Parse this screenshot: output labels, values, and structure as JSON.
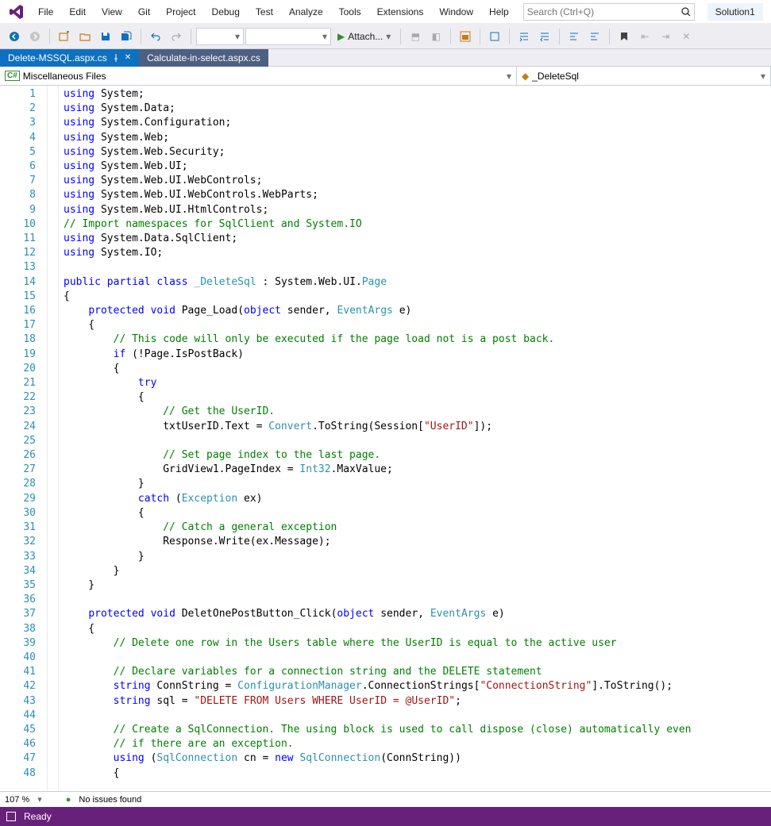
{
  "menu": {
    "items": [
      "File",
      "Edit",
      "View",
      "Git",
      "Project",
      "Debug",
      "Test",
      "Analyze",
      "Tools",
      "Extensions",
      "Window",
      "Help"
    ]
  },
  "search": {
    "placeholder": "Search (Ctrl+Q)"
  },
  "solution": {
    "label": "Solution1"
  },
  "toolbar": {
    "attach_label": "Attach..."
  },
  "tabs": [
    {
      "label": "Delete-MSSQL.aspx.cs",
      "active": true,
      "pinned": true
    },
    {
      "label": "Calculate-in-select.aspx.cs",
      "active": false,
      "pinned": false
    }
  ],
  "nav": {
    "left": "Miscellaneous Files",
    "right": "_DeleteSql"
  },
  "status": {
    "zoom": "107 %",
    "issues": "No issues found",
    "ready": "Ready"
  },
  "code": {
    "lines": [
      {
        "n": 1,
        "html": "<span class='kw'>using</span> System;"
      },
      {
        "n": 2,
        "html": "<span class='kw'>using</span> System.Data;"
      },
      {
        "n": 3,
        "html": "<span class='kw'>using</span> System.Configuration;"
      },
      {
        "n": 4,
        "html": "<span class='kw'>using</span> System.Web;"
      },
      {
        "n": 5,
        "html": "<span class='kw'>using</span> System.Web.Security;"
      },
      {
        "n": 6,
        "html": "<span class='kw'>using</span> System.Web.UI;"
      },
      {
        "n": 7,
        "html": "<span class='kw'>using</span> System.Web.UI.WebControls;"
      },
      {
        "n": 8,
        "html": "<span class='kw'>using</span> System.Web.UI.WebControls.WebParts;"
      },
      {
        "n": 9,
        "html": "<span class='kw'>using</span> System.Web.UI.HtmlControls;"
      },
      {
        "n": 10,
        "html": "<span class='cm'>// Import namespaces for SqlClient and System.IO</span>"
      },
      {
        "n": 11,
        "html": "<span class='kw'>using</span> System.Data.SqlClient;"
      },
      {
        "n": 12,
        "html": "<span class='kw'>using</span> System.IO;"
      },
      {
        "n": 13,
        "html": ""
      },
      {
        "n": 14,
        "html": "<span class='kw'>public</span> <span class='kw'>partial</span> <span class='kw'>class</span> <span class='type'>_DeleteSql</span> : System.Web.UI.<span class='type'>Page</span>"
      },
      {
        "n": 15,
        "html": "{"
      },
      {
        "n": 16,
        "html": "    <span class='kw'>protected</span> <span class='kw'>void</span> <span class='ident'>Page_Load</span>(<span class='kw'>object</span> sender, <span class='type'>EventArgs</span> e)"
      },
      {
        "n": 17,
        "html": "    {"
      },
      {
        "n": 18,
        "html": "        <span class='cm'>// This code will only be executed if the page load not is a post back.</span>"
      },
      {
        "n": 19,
        "html": "        <span class='kw'>if</span> (!Page.IsPostBack)"
      },
      {
        "n": 20,
        "html": "        {"
      },
      {
        "n": 21,
        "html": "            <span class='kw'>try</span>"
      },
      {
        "n": 22,
        "html": "            {"
      },
      {
        "n": 23,
        "html": "                <span class='cm'>// Get the UserID.</span>"
      },
      {
        "n": 24,
        "html": "                txtUserID.Text = <span class='type'>Convert</span>.ToString(Session[<span class='str'>\"UserID\"</span>]);"
      },
      {
        "n": 25,
        "html": ""
      },
      {
        "n": 26,
        "html": "                <span class='cm'>// Set page index to the last page.</span>"
      },
      {
        "n": 27,
        "html": "                GridView1.PageIndex = <span class='type'>Int32</span>.MaxValue;"
      },
      {
        "n": 28,
        "html": "            }"
      },
      {
        "n": 29,
        "html": "            <span class='kw'>catch</span> (<span class='type'>Exception</span> ex)"
      },
      {
        "n": 30,
        "html": "            {"
      },
      {
        "n": 31,
        "html": "                <span class='cm'>// Catch a general exception</span>"
      },
      {
        "n": 32,
        "html": "                Response.Write(ex.Message);"
      },
      {
        "n": 33,
        "html": "            }"
      },
      {
        "n": 34,
        "html": "        }"
      },
      {
        "n": 35,
        "html": "    }"
      },
      {
        "n": 36,
        "html": ""
      },
      {
        "n": 37,
        "html": "    <span class='kw'>protected</span> <span class='kw'>void</span> <span class='ident'>DeletOnePostButton_Click</span>(<span class='kw'>object</span> sender, <span class='type'>EventArgs</span> e)"
      },
      {
        "n": 38,
        "html": "    {"
      },
      {
        "n": 39,
        "html": "        <span class='cm'>// Delete one row in the Users table where the UserID is equal to the active user</span>"
      },
      {
        "n": 40,
        "html": ""
      },
      {
        "n": 41,
        "html": "        <span class='cm'>// Declare variables for a connection string and the DELETE statement</span>"
      },
      {
        "n": 42,
        "html": "        <span class='kw'>string</span> ConnString = <span class='type'>ConfigurationManager</span>.ConnectionStrings[<span class='str'>\"ConnectionString\"</span>].ToString();"
      },
      {
        "n": 43,
        "html": "        <span class='kw'>string</span> sql = <span class='str'>\"DELETE FROM Users WHERE UserID = @UserID\"</span>;"
      },
      {
        "n": 44,
        "html": ""
      },
      {
        "n": 45,
        "html": "        <span class='cm'>// Create a SqlConnection. The using block is used to call dispose (close) automatically even</span>"
      },
      {
        "n": 46,
        "html": "        <span class='cm'>// if there are an exception.</span>"
      },
      {
        "n": 47,
        "html": "        <span class='kw'>using</span> (<span class='type'>SqlConnection</span> cn = <span class='kw'>new</span> <span class='type'>SqlConnection</span>(ConnString))"
      },
      {
        "n": 48,
        "html": "        {"
      }
    ]
  }
}
